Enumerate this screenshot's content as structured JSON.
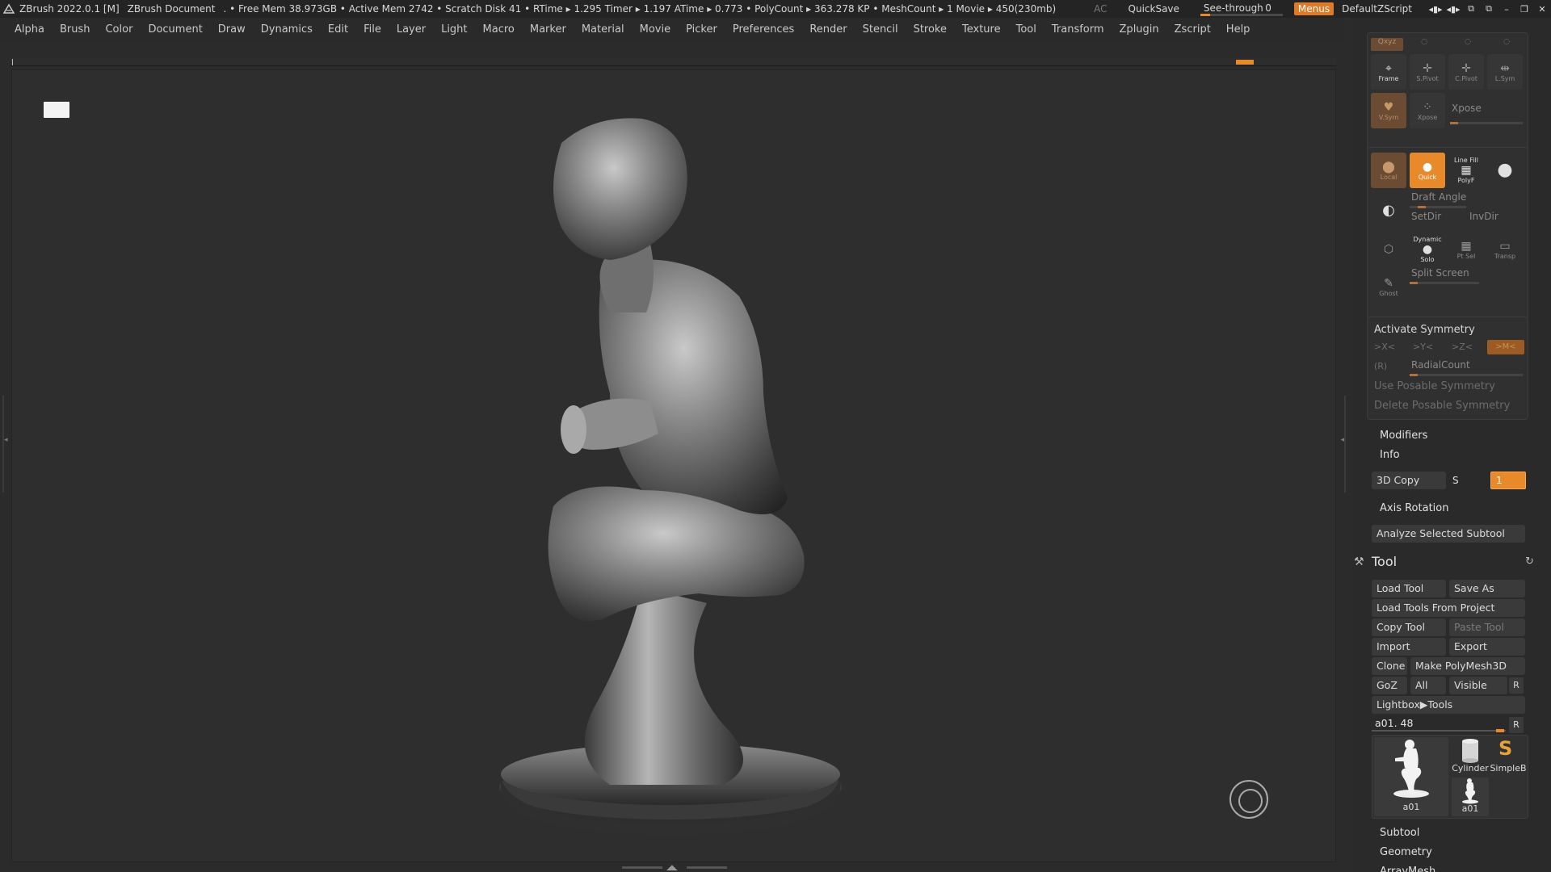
{
  "titlebar": {
    "app": "ZBrush 2022.0.1 [M]",
    "document": "ZBrush Document",
    "stats": ". • Free Mem 38.973GB • Active Mem 2742 • Scratch Disk 41 •  RTime ▸ 1.295 Timer ▸ 1.197 ATime ▸ 0.773 • PolyCount ▸ 363.278 KP  • MeshCount ▸ 1  Movie ▸ 450(230mb)",
    "ac": "AC",
    "quicksave": "QuickSave",
    "see_through_label": "See-through",
    "see_through_value": "0",
    "menus": "Menus",
    "script": "DefaultZScript"
  },
  "menubar": [
    "Alpha",
    "Brush",
    "Color",
    "Document",
    "Draw",
    "Dynamics",
    "Edit",
    "File",
    "Layer",
    "Light",
    "Macro",
    "Marker",
    "Material",
    "Movie",
    "Picker",
    "Preferences",
    "Render",
    "Stencil",
    "Stroke",
    "Texture",
    "Tool",
    "Transform",
    "Zplugin",
    "Zscript",
    "Help"
  ],
  "panel": {
    "top_buttons": [
      {
        "label": "Frame",
        "icon": "frame-icon"
      },
      {
        "label": "S.Pivot",
        "icon": "spivot-icon"
      },
      {
        "label": "C.Pivot",
        "icon": "cpivot-icon"
      },
      {
        "label": "L.Sym",
        "icon": "lsym-icon"
      }
    ],
    "xyz_label": "Qxyz",
    "vsym": "V.Sym",
    "xpose": "Xpose",
    "xpose_slider": "Xpose",
    "local": "Local",
    "quick": "Quick",
    "linefill": "Line Fill",
    "polyf": "PolyF",
    "draft_angle": "Draft Angle",
    "setdir": "SetDir",
    "invdir": "InvDir",
    "dynamic": "Dynamic",
    "solo": "Solo",
    "ptsel": "Pt Sel",
    "transp": "Transp",
    "ghost": "Ghost",
    "split_screen": "Split Screen",
    "activate_symmetry": "Activate Symmetry",
    "sym_x": ">X<",
    "sym_y": ">Y<",
    "sym_z": ">Z<",
    "sym_m": ">M<",
    "sym_r": "(R)",
    "radial_count": "RadialCount",
    "use_posable": "Use Posable Symmetry",
    "delete_posable": "Delete Posable Symmetry",
    "modifiers": "Modifiers",
    "info": "Info",
    "copy3d": "3D Copy",
    "copy_s": "S",
    "copy_value": "1",
    "axis_rotation": "Axis Rotation",
    "analyze": "Analyze Selected Subtool",
    "tool_title": "Tool",
    "load_tool": "Load Tool",
    "save_as": "Save As",
    "load_from_project": "Load Tools From Project",
    "copy_tool": "Copy Tool",
    "paste_tool": "Paste Tool",
    "import": "Import",
    "export": "Export",
    "clone": "Clone",
    "make_polymesh": "Make PolyMesh3D",
    "goz": "GoZ",
    "all": "All",
    "visible": "Visible",
    "r": "R",
    "lightbox_tools": "Lightbox▶Tools",
    "current_tool": "a01. 48",
    "thumbs": {
      "main": "a01",
      "cylinder": "Cylinder",
      "simpleb": "SimpleB",
      "small": "a01"
    },
    "subtool": "Subtool",
    "geometry": "Geometry",
    "arraymesh": "ArrayMesh"
  },
  "colors": {
    "accent": "#e8892a",
    "panel": "#303030",
    "bg": "#2b2b2b"
  }
}
